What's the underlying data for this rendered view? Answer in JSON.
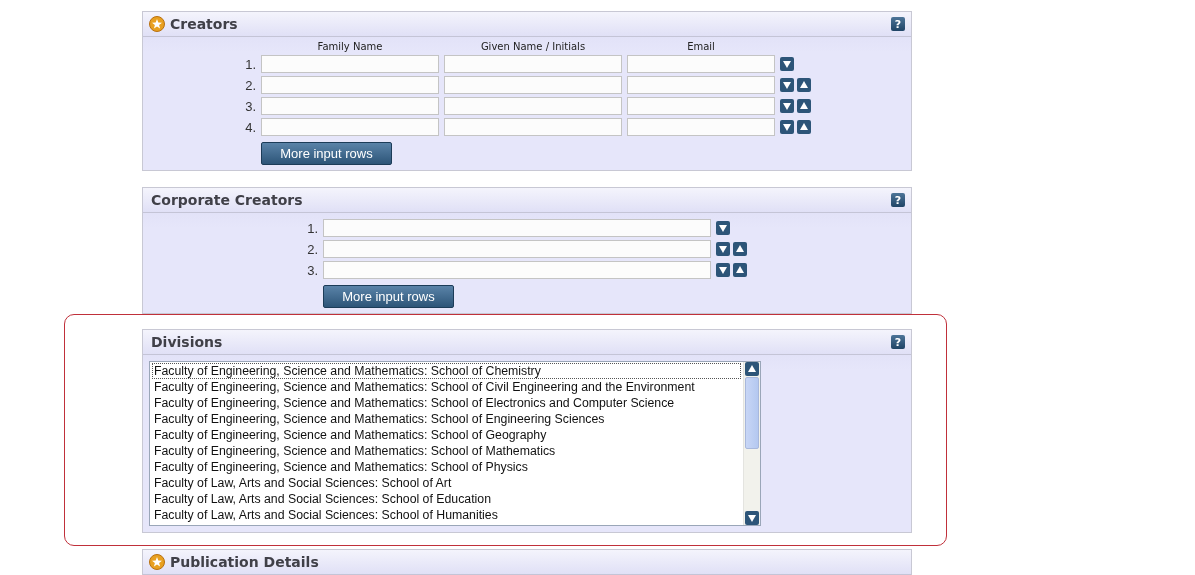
{
  "sections": [
    {
      "kind": "creators",
      "title": "Creators",
      "required": true,
      "help": "?",
      "columns": [
        "Family Name",
        "Given Name / Initials",
        "Email"
      ],
      "rows": [
        {
          "number": "1.",
          "move_down": true,
          "move_up": false
        },
        {
          "number": "2.",
          "move_down": true,
          "move_up": true
        },
        {
          "number": "3.",
          "move_down": true,
          "move_up": true
        },
        {
          "number": "4.",
          "move_down": true,
          "move_up": true
        }
      ],
      "more_button": "More input rows"
    },
    {
      "kind": "corporate",
      "title": "Corporate Creators",
      "required": false,
      "help": "?",
      "rows": [
        {
          "number": "1.",
          "move_down": true,
          "move_up": false
        },
        {
          "number": "2.",
          "move_down": true,
          "move_up": true
        },
        {
          "number": "3.",
          "move_down": true,
          "move_up": true
        }
      ],
      "more_button": "More input rows"
    },
    {
      "kind": "divisions",
      "title": "Divisions",
      "required": false,
      "help": "?",
      "highlighted": true,
      "items": [
        {
          "label": "Faculty of Engineering, Science and Mathematics: School of Chemistry",
          "focused": true
        },
        {
          "label": "Faculty of Engineering, Science and Mathematics: School of Civil Engineering and the Environment",
          "focused": false
        },
        {
          "label": "Faculty of Engineering, Science and Mathematics: School of Electronics and Computer Science",
          "focused": false
        },
        {
          "label": "Faculty of Engineering, Science and Mathematics: School of Engineering Sciences",
          "focused": false
        },
        {
          "label": "Faculty of Engineering, Science and Mathematics: School of Geography",
          "focused": false
        },
        {
          "label": "Faculty of Engineering, Science and Mathematics: School of Mathematics",
          "focused": false
        },
        {
          "label": "Faculty of Engineering, Science and Mathematics: School of Physics",
          "focused": false
        },
        {
          "label": "Faculty of Law, Arts and Social Sciences: School of Art",
          "focused": false
        },
        {
          "label": "Faculty of Law, Arts and Social Sciences: School of Education",
          "focused": false
        },
        {
          "label": "Faculty of Law, Arts and Social Sciences: School of Humanities",
          "focused": false
        }
      ]
    },
    {
      "kind": "header_only",
      "title": "Publication Details",
      "required": true
    }
  ]
}
